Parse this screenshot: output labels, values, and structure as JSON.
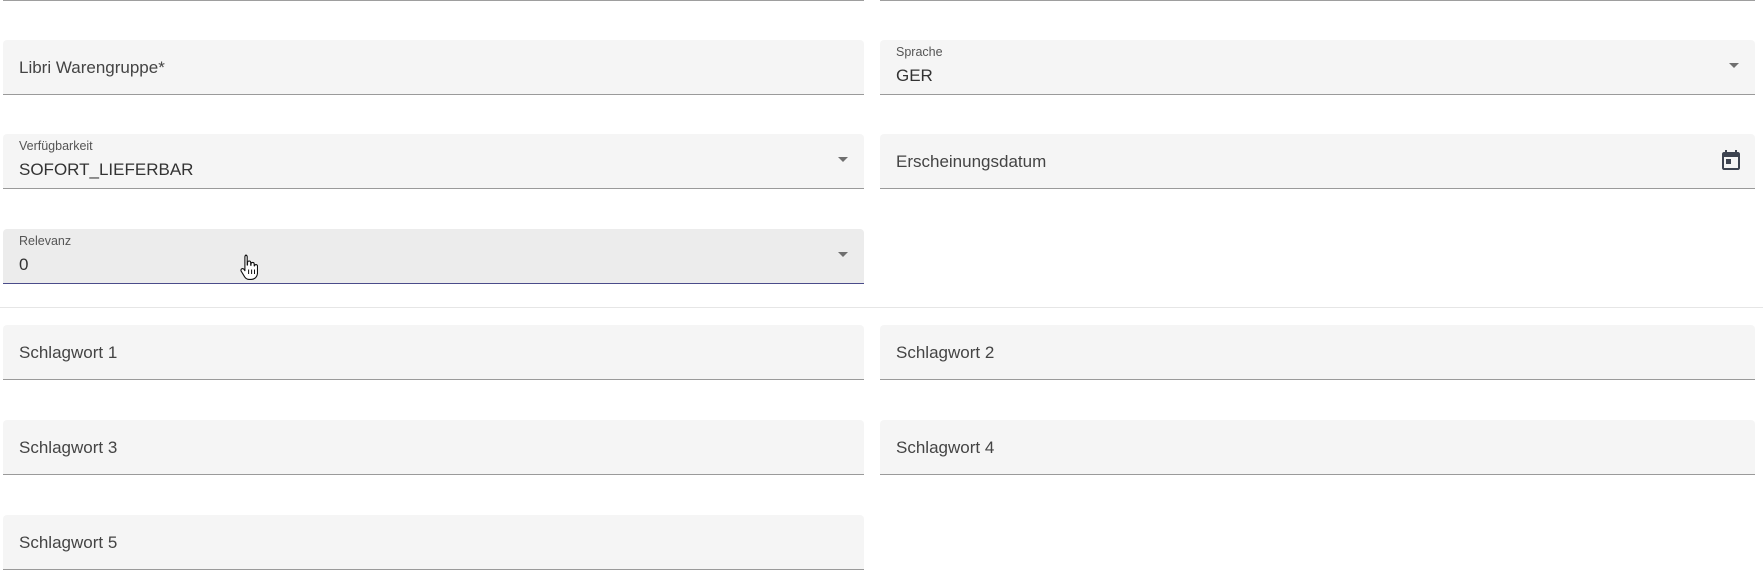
{
  "form": {
    "libri_warengruppe": {
      "placeholder": "Libri Warengruppe*"
    },
    "sprache": {
      "label": "Sprache",
      "value": "GER"
    },
    "verfuegbarkeit": {
      "label": "Verfügbarkeit",
      "value": "SOFORT_LIEFERBAR"
    },
    "erscheinungsdatum": {
      "placeholder": "Erscheinungsdatum"
    },
    "relevanz": {
      "label": "Relevanz",
      "value": "0"
    },
    "schlagwort_1": {
      "placeholder": "Schlagwort 1"
    },
    "schlagwort_2": {
      "placeholder": "Schlagwort 2"
    },
    "schlagwort_3": {
      "placeholder": "Schlagwort 3"
    },
    "schlagwort_4": {
      "placeholder": "Schlagwort 4"
    },
    "schlagwort_5": {
      "placeholder": "Schlagwort 5"
    }
  },
  "icons": {
    "dropdown": "arrow-drop-down-icon",
    "datepicker": "calendar-icon",
    "pointer": "hand-cursor-icon"
  },
  "colors": {
    "field_background": "#f5f5f5",
    "field_underline": "#9a9a9a",
    "focused_underline": "#4a4c8a",
    "text": "#333333"
  }
}
